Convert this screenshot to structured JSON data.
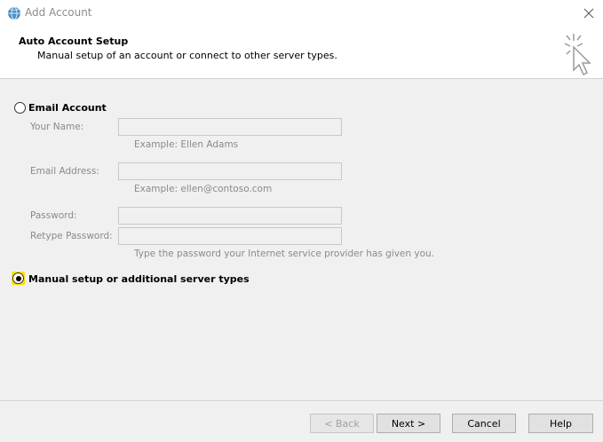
{
  "window": {
    "title": "Add Account",
    "icon": "outlook-globe-icon"
  },
  "header": {
    "title": "Auto Account Setup",
    "subtitle": "Manual setup of an account or connect to other server types."
  },
  "options": {
    "email_account": {
      "label": "Email Account",
      "checked": false
    },
    "manual_setup": {
      "label": "Manual setup or additional server types",
      "checked": true
    }
  },
  "fields": {
    "your_name": {
      "label": "Your Name:",
      "value": "",
      "hint": "Example: Ellen Adams"
    },
    "email_address": {
      "label": "Email Address:",
      "value": "",
      "hint": "Example: ellen@contoso.com"
    },
    "password": {
      "label": "Password:",
      "value": ""
    },
    "retype_password": {
      "label": "Retype Password:",
      "value": "",
      "hint": "Type the password your Internet service provider has given you."
    }
  },
  "buttons": {
    "back": "< Back",
    "next": "Next >",
    "cancel": "Cancel",
    "help": "Help"
  },
  "colors": {
    "highlight": "#ffe000",
    "disabled_text": "#8a8a8a"
  }
}
